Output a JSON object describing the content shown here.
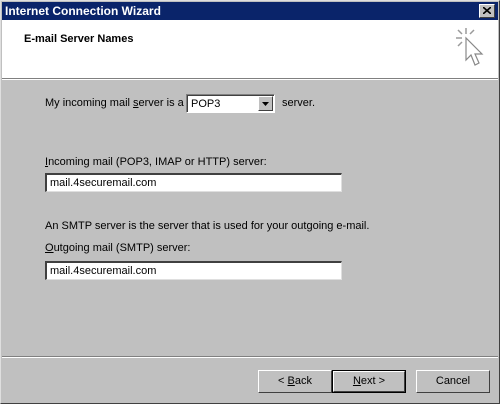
{
  "window": {
    "title": "Internet Connection Wizard"
  },
  "header": {
    "title": "E-mail Server Names",
    "icon": "wizard-cursor-icon"
  },
  "form": {
    "incoming_server_prefix": "My incoming mail ",
    "incoming_server_access": "s",
    "incoming_server_suffix": "erver is a",
    "server_type_value": "POP3",
    "server_type_after": "server.",
    "incoming_label_access": "I",
    "incoming_label_rest": "ncoming mail (POP3, IMAP or HTTP) server:",
    "incoming_value": "mail.4securemail.com",
    "smtp_description": "An SMTP server is the server that is used for your outgoing e-mail.",
    "outgoing_label_access": "O",
    "outgoing_label_rest": "utgoing mail (SMTP) server:",
    "outgoing_value": "mail.4securemail.com"
  },
  "buttons": {
    "back_prefix": "< ",
    "back_access": "B",
    "back_rest": "ack",
    "next_access": "N",
    "next_rest": "ext >",
    "cancel": "Cancel"
  }
}
